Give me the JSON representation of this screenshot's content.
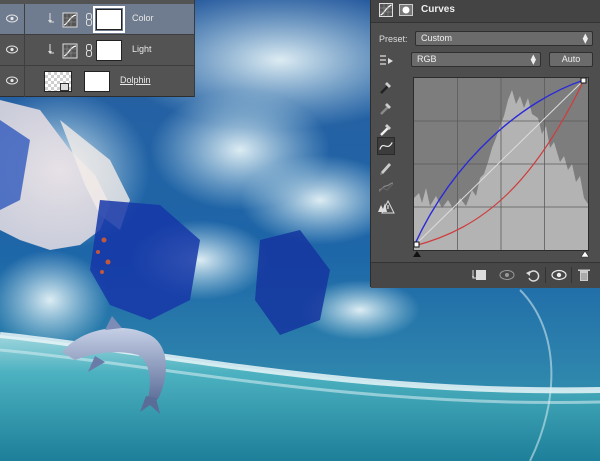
{
  "layers": [
    {
      "name": "Color",
      "selected": true,
      "type": "adjustment",
      "clipped": true
    },
    {
      "name": "Light",
      "selected": false,
      "type": "adjustment",
      "clipped": true
    },
    {
      "name": "Dolphin",
      "selected": false,
      "type": "smart-object",
      "clipped": false
    }
  ],
  "properties": {
    "title": "Curves",
    "preset_label": "Preset:",
    "preset_value": "Custom",
    "channel_value": "RGB",
    "auto_label": "Auto",
    "tools": [
      "on-image-adjust-icon",
      "black-point-eyedropper-icon",
      "gray-point-eyedropper-icon",
      "white-point-eyedropper-icon",
      "curve-edit-points-icon",
      "pencil-draw-icon",
      "smooth-curve-icon",
      "clipping-warning-icon"
    ],
    "footer_icons": [
      "clip-to-layer-icon",
      "view-previous-state-icon",
      "reset-icon",
      "visibility-icon",
      "delete-icon"
    ]
  },
  "colors": {
    "selected_layer": "#6f7b8e",
    "panel_bg": "#4e4e4e",
    "curve_rgb": "#2a2ad8",
    "curve_red": "#d03a3a",
    "diagonal": "#d8d8d8",
    "histogram": "#b4b4b4"
  }
}
